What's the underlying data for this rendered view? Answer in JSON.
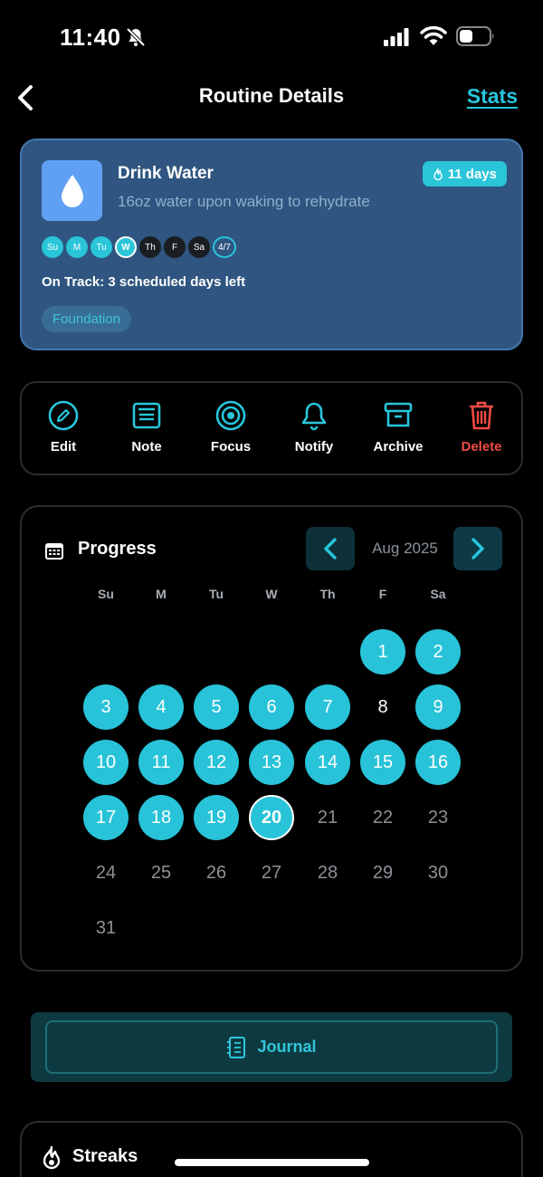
{
  "status_bar": {
    "time": "11:40"
  },
  "nav": {
    "title": "Routine Details",
    "stats_link": "Stats"
  },
  "routine": {
    "title": "Drink Water",
    "description": "16oz water upon waking to rehydrate",
    "streak": "11 days",
    "days": [
      {
        "label": "Su",
        "state": "done"
      },
      {
        "label": "M",
        "state": "done"
      },
      {
        "label": "Tu",
        "state": "done"
      },
      {
        "label": "W",
        "state": "today"
      },
      {
        "label": "Th",
        "state": "empty"
      },
      {
        "label": "F",
        "state": "empty"
      },
      {
        "label": "Sa",
        "state": "empty"
      }
    ],
    "count": "4/7",
    "status": "On Track: 3 scheduled days left",
    "tag": "Foundation",
    "accent_color": "#2ac5d9"
  },
  "actions": [
    {
      "label": "Edit",
      "icon": "edit-icon"
    },
    {
      "label": "Note",
      "icon": "note-icon"
    },
    {
      "label": "Focus",
      "icon": "focus-icon"
    },
    {
      "label": "Notify",
      "icon": "bell-icon"
    },
    {
      "label": "Archive",
      "icon": "archive-icon"
    },
    {
      "label": "Delete",
      "icon": "trash-icon",
      "color": "#f04b44"
    }
  ],
  "progress": {
    "title": "Progress",
    "month": "Aug 2025",
    "weekdays": [
      "Su",
      "M",
      "Tu",
      "W",
      "Th",
      "F",
      "Sa"
    ],
    "first_weekday_index": 5,
    "days_in_month": 31,
    "completed_days": [
      1,
      2,
      3,
      4,
      5,
      6,
      7,
      9,
      10,
      11,
      12,
      13,
      14,
      15,
      16,
      17,
      18,
      19,
      20
    ],
    "today": 20,
    "past_incomplete_days": [
      8
    ]
  },
  "journal": {
    "label": "Journal"
  },
  "streaks": {
    "title": "Streaks"
  }
}
